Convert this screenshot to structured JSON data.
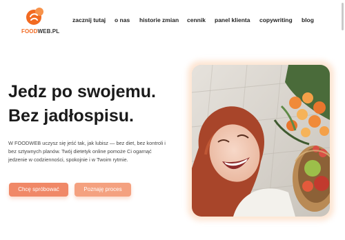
{
  "brand": {
    "name_part1": "FOOD",
    "name_part2": "WEB.PL",
    "accent": "#f26a21"
  },
  "nav": {
    "items": [
      {
        "label": "zacznij tutaj"
      },
      {
        "label": "o nas"
      },
      {
        "label": "historie zmian"
      },
      {
        "label": "cennik"
      },
      {
        "label": "panel klienta"
      },
      {
        "label": "copywriting"
      },
      {
        "label": "blog"
      }
    ]
  },
  "hero": {
    "headline_line1": "Jedz po swojemu.",
    "headline_line2": "Bez jadłospisu.",
    "lead": "W FOODWEB uczysz się jeść tak, jak lubisz — bez diet, bez kontroli i bez sztywnych planów. Twój dietetyk online pomoże Ci ogarnąć jedzenie w codzienności, spokojnie i w Twoim rytmie.",
    "primary_button": "Chcę spróbować",
    "secondary_button": "Poznaję proces"
  },
  "colors": {
    "primary_button": "#f08867",
    "secondary_button": "#f4a180"
  },
  "icons": {
    "logo": "foodweb-logo-icon"
  }
}
